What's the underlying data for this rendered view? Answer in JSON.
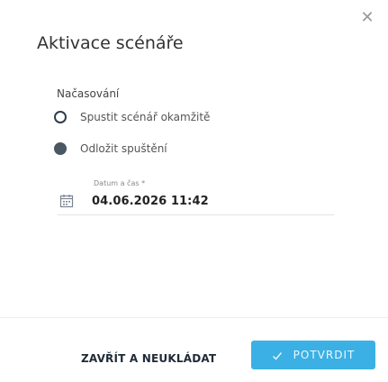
{
  "dialog": {
    "title": "Aktivace scénáře",
    "close_icon": "close-icon"
  },
  "timing": {
    "section_label": "Načasování",
    "options": [
      {
        "label": "Spustit scénář okamžitě",
        "selected": false
      },
      {
        "label": "Odložit spuštění",
        "selected": true
      }
    ]
  },
  "datetime": {
    "label": "Datum a čas *",
    "value": "04.06.2026 11:42",
    "icon": "calendar-icon"
  },
  "footer": {
    "close_label": "ZAVŘÍT A NEUKLÁDAT",
    "confirm_label": "POTVRDIT",
    "confirm_icon": "check-icon",
    "confirm_color": "#1aa3e0"
  }
}
